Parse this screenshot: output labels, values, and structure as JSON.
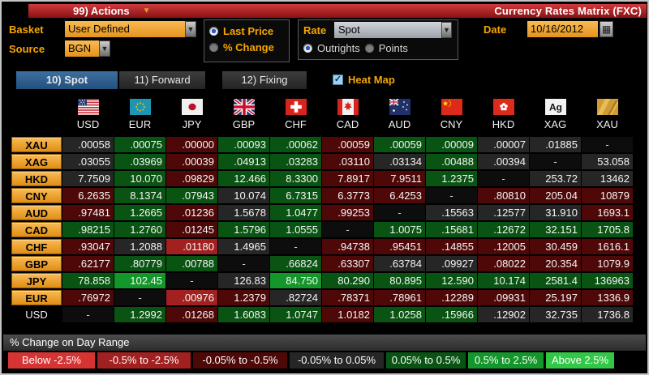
{
  "title_bar": {
    "actions_label": "99) Actions",
    "title": "Currency Rates Matrix (FXC)"
  },
  "controls": {
    "basket_label": "Basket",
    "basket_value": "User Defined",
    "source_label": "Source",
    "source_value": "BGN",
    "price_mode": {
      "options": [
        "Last Price",
        "% Change"
      ],
      "selected": "Last Price"
    },
    "rate_label": "Rate",
    "rate_value": "Spot",
    "rate_mode": {
      "options": [
        "Outrights",
        "Points"
      ],
      "selected": "Outrights"
    },
    "date_label": "Date",
    "date_value": "10/16/2012"
  },
  "tabs": [
    {
      "label": "10) Spot",
      "active": true
    },
    {
      "label": "11) Forward",
      "active": false
    },
    {
      "label": "12) Fixing",
      "active": false
    }
  ],
  "heat_map": {
    "label": "Heat Map",
    "checked": true
  },
  "matrix": {
    "columns": [
      "USD",
      "EUR",
      "JPY",
      "GBP",
      "CHF",
      "CAD",
      "AUD",
      "CNY",
      "HKD",
      "XAG",
      "XAU"
    ],
    "rows": [
      {
        "label": "XAU",
        "button": true,
        "cells": [
          [
            ".00058",
            "n"
          ],
          [
            ".00075",
            "g"
          ],
          [
            ".00000",
            "r"
          ],
          [
            ".00093",
            "g"
          ],
          [
            ".00062",
            "g"
          ],
          [
            ".00059",
            "r"
          ],
          [
            ".00059",
            "g"
          ],
          [
            ".00009",
            "g"
          ],
          [
            ".00007",
            "n"
          ],
          [
            ".01885",
            "n"
          ],
          [
            "-",
            "b"
          ]
        ]
      },
      {
        "label": "XAG",
        "button": true,
        "cells": [
          [
            ".03055",
            "n"
          ],
          [
            ".03969",
            "g"
          ],
          [
            ".00039",
            "r"
          ],
          [
            ".04913",
            "g"
          ],
          [
            ".03283",
            "g"
          ],
          [
            ".03110",
            "r"
          ],
          [
            ".03134",
            "n"
          ],
          [
            ".00488",
            "g"
          ],
          [
            ".00394",
            "n"
          ],
          [
            "-",
            "b"
          ],
          [
            "53.058",
            "n"
          ]
        ]
      },
      {
        "label": "HKD",
        "button": true,
        "cells": [
          [
            "7.7509",
            "n"
          ],
          [
            "10.070",
            "g"
          ],
          [
            ".09829",
            "r"
          ],
          [
            "12.466",
            "g"
          ],
          [
            "8.3300",
            "g"
          ],
          [
            "7.8917",
            "r"
          ],
          [
            "7.9511",
            "r"
          ],
          [
            "1.2375",
            "g"
          ],
          [
            "-",
            "b"
          ],
          [
            "253.72",
            "n"
          ],
          [
            "13462",
            "n"
          ]
        ]
      },
      {
        "label": "CNY",
        "button": true,
        "cells": [
          [
            "6.2635",
            "r"
          ],
          [
            "8.1374",
            "g"
          ],
          [
            ".07943",
            "g"
          ],
          [
            "10.074",
            "n"
          ],
          [
            "6.7315",
            "g"
          ],
          [
            "6.3773",
            "r"
          ],
          [
            "6.4253",
            "r"
          ],
          [
            "-",
            "b"
          ],
          [
            ".80810",
            "r"
          ],
          [
            "205.04",
            "r"
          ],
          [
            "10879",
            "r"
          ]
        ]
      },
      {
        "label": "AUD",
        "button": true,
        "cells": [
          [
            ".97481",
            "r"
          ],
          [
            "1.2665",
            "g"
          ],
          [
            ".01236",
            "r"
          ],
          [
            "1.5678",
            "n"
          ],
          [
            "1.0477",
            "g"
          ],
          [
            ".99253",
            "r"
          ],
          [
            "-",
            "b"
          ],
          [
            ".15563",
            "n"
          ],
          [
            ".12577",
            "n"
          ],
          [
            "31.910",
            "n"
          ],
          [
            "1693.1",
            "r"
          ]
        ]
      },
      {
        "label": "CAD",
        "button": true,
        "cells": [
          [
            ".98215",
            "g"
          ],
          [
            "1.2760",
            "g"
          ],
          [
            ".01245",
            "r"
          ],
          [
            "1.5796",
            "g"
          ],
          [
            "1.0555",
            "g"
          ],
          [
            "-",
            "b"
          ],
          [
            "1.0075",
            "g"
          ],
          [
            ".15681",
            "g"
          ],
          [
            ".12672",
            "g"
          ],
          [
            "32.151",
            "g"
          ],
          [
            "1705.8",
            "g"
          ]
        ]
      },
      {
        "label": "CHF",
        "button": true,
        "cells": [
          [
            ".93047",
            "r"
          ],
          [
            "1.2088",
            "n"
          ],
          [
            ".01180",
            "R"
          ],
          [
            "1.4965",
            "n"
          ],
          [
            "-",
            "b"
          ],
          [
            ".94738",
            "r"
          ],
          [
            ".95451",
            "r"
          ],
          [
            ".14855",
            "r"
          ],
          [
            ".12005",
            "r"
          ],
          [
            "30.459",
            "r"
          ],
          [
            "1616.1",
            "r"
          ]
        ]
      },
      {
        "label": "GBP",
        "button": true,
        "cells": [
          [
            ".62177",
            "r"
          ],
          [
            ".80779",
            "g"
          ],
          [
            ".00788",
            "g"
          ],
          [
            "-",
            "b"
          ],
          [
            ".66824",
            "g"
          ],
          [
            ".63307",
            "r"
          ],
          [
            ".63784",
            "n"
          ],
          [
            ".09927",
            "n"
          ],
          [
            ".08022",
            "r"
          ],
          [
            "20.354",
            "r"
          ],
          [
            "1079.9",
            "r"
          ]
        ]
      },
      {
        "label": "JPY",
        "button": true,
        "cells": [
          [
            "78.858",
            "g"
          ],
          [
            "102.45",
            "G"
          ],
          [
            "-",
            "b"
          ],
          [
            "126.83",
            "n"
          ],
          [
            "84.750",
            "G"
          ],
          [
            "80.290",
            "g"
          ],
          [
            "80.895",
            "g"
          ],
          [
            "12.590",
            "g"
          ],
          [
            "10.174",
            "g"
          ],
          [
            "2581.4",
            "g"
          ],
          [
            "136963",
            "g"
          ]
        ]
      },
      {
        "label": "EUR",
        "button": true,
        "cells": [
          [
            ".76972",
            "r"
          ],
          [
            "-",
            "b"
          ],
          [
            ".00976",
            "R"
          ],
          [
            "1.2379",
            "r"
          ],
          [
            ".82724",
            "n"
          ],
          [
            ".78371",
            "r"
          ],
          [
            ".78961",
            "r"
          ],
          [
            ".12289",
            "r"
          ],
          [
            ".09931",
            "r"
          ],
          [
            "25.197",
            "r"
          ],
          [
            "1336.9",
            "r"
          ]
        ]
      },
      {
        "label": "USD",
        "button": false,
        "cells": [
          [
            "-",
            "b"
          ],
          [
            "1.2992",
            "g"
          ],
          [
            ".01268",
            "r"
          ],
          [
            "1.6083",
            "g"
          ],
          [
            "1.0747",
            "g"
          ],
          [
            "1.0182",
            "r"
          ],
          [
            "1.0258",
            "g"
          ],
          [
            ".15966",
            "g"
          ],
          [
            ".12902",
            "n"
          ],
          [
            "32.735",
            "n"
          ],
          [
            "1736.8",
            "n"
          ]
        ]
      }
    ]
  },
  "heat_colors": {
    "R": "#a32020",
    "r": "#4e0808",
    "n": "#262626",
    "g": "#0a5413",
    "G": "#13962a",
    "b": "#0d0d0d"
  },
  "footer": {
    "range_label": "% Change on Day Range"
  },
  "legend": [
    {
      "label": "Below -2.5%",
      "color": "#d63333"
    },
    {
      "label": "-0.5% to -2.5%",
      "color": "#a32020"
    },
    {
      "label": "-0.05% to -0.5%",
      "color": "#4e0808"
    },
    {
      "label": "-0.05% to 0.05%",
      "color": "#262626"
    },
    {
      "label": "0.05% to 0.5%",
      "color": "#0a5413"
    },
    {
      "label": "0.5% to 2.5%",
      "color": "#13962a"
    },
    {
      "label": "Above 2.5%",
      "color": "#32c846"
    }
  ]
}
